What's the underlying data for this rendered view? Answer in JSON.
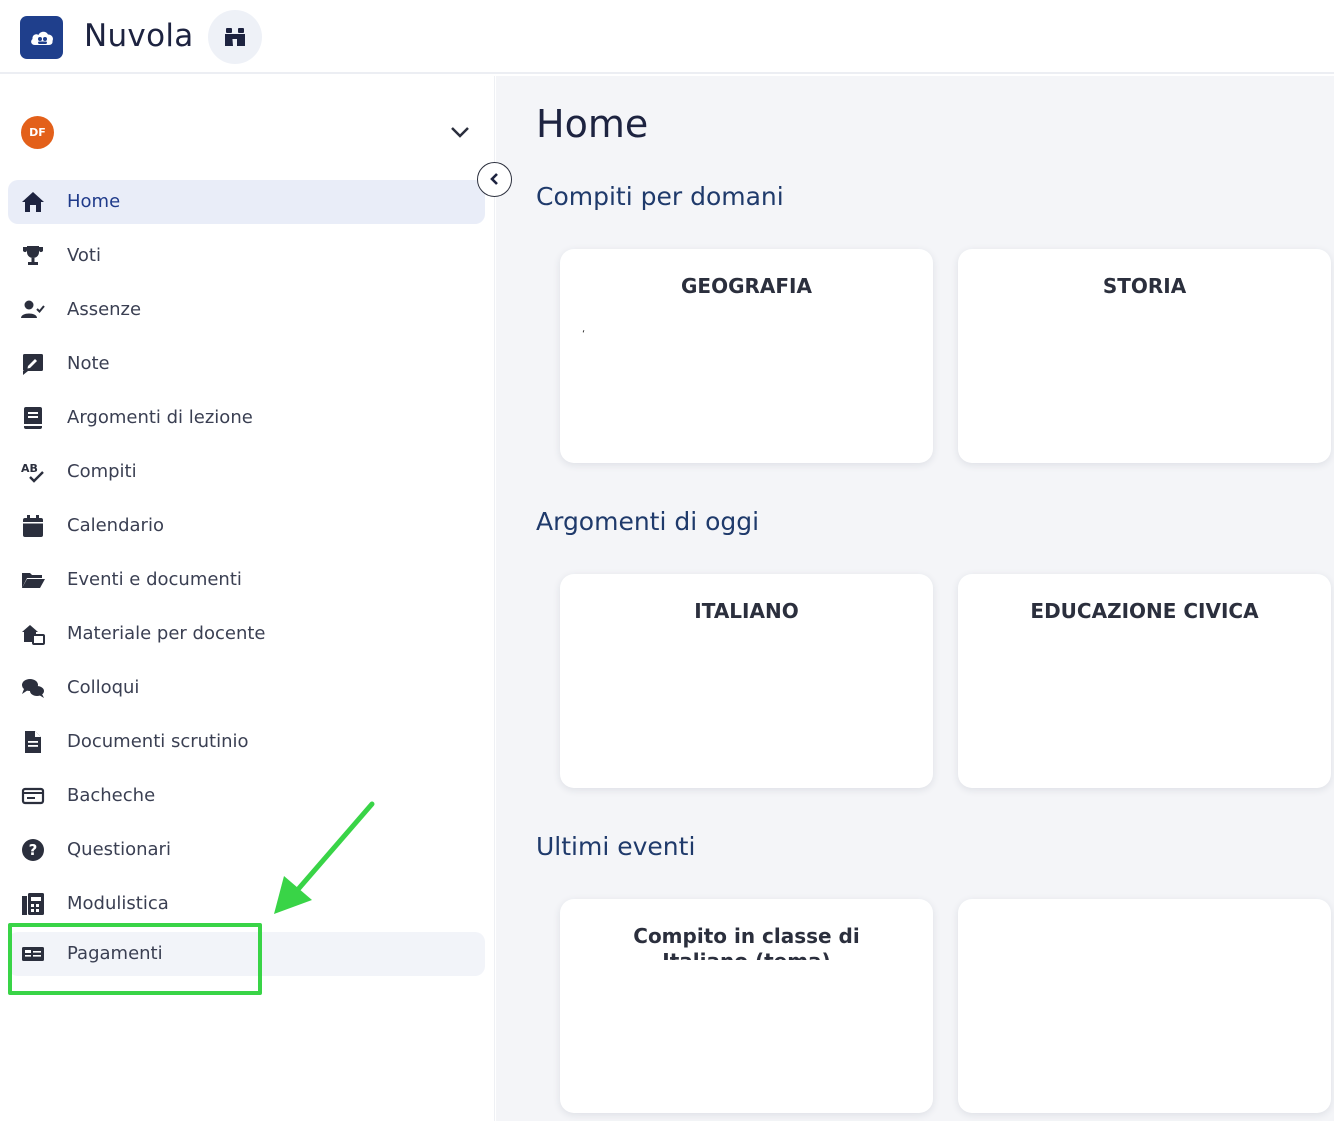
{
  "app": {
    "title": "Nuvola"
  },
  "user": {
    "initials": "DF"
  },
  "sidebar": {
    "items": [
      {
        "label": "Home",
        "icon": "home-icon"
      },
      {
        "label": "Voti",
        "icon": "trophy-icon"
      },
      {
        "label": "Assenze",
        "icon": "user-check-icon"
      },
      {
        "label": "Note",
        "icon": "note-icon"
      },
      {
        "label": "Argomenti di lezione",
        "icon": "book-icon"
      },
      {
        "label": "Compiti",
        "icon": "spellcheck-icon"
      },
      {
        "label": "Calendario",
        "icon": "calendar-icon"
      },
      {
        "label": "Eventi e documenti",
        "icon": "folder-icon"
      },
      {
        "label": "Materiale per docente",
        "icon": "material-icon"
      },
      {
        "label": "Colloqui",
        "icon": "chat-icon"
      },
      {
        "label": "Documenti scrutinio",
        "icon": "document-icon"
      },
      {
        "label": "Bacheche",
        "icon": "board-icon"
      },
      {
        "label": "Questionari",
        "icon": "question-icon"
      },
      {
        "label": "Modulistica",
        "icon": "form-icon"
      },
      {
        "label": "Pagamenti",
        "icon": "payment-icon"
      }
    ]
  },
  "main": {
    "title": "Home",
    "sections": [
      {
        "title": "Compiti per domani",
        "cards": [
          "GEOGRAFIA",
          "STORIA"
        ],
        "mark": "‘"
      },
      {
        "title": "Argomenti di oggi",
        "cards": [
          "ITALIANO",
          "EDUCAZIONE CIVICA"
        ]
      },
      {
        "title": "Ultimi eventi",
        "cards": [
          "Compito in classe di Italiano (tema)",
          ""
        ]
      }
    ]
  },
  "colors": {
    "brand": "#1f3f8c",
    "highlight": "#39d447",
    "active_bg": "#e9edf8"
  }
}
